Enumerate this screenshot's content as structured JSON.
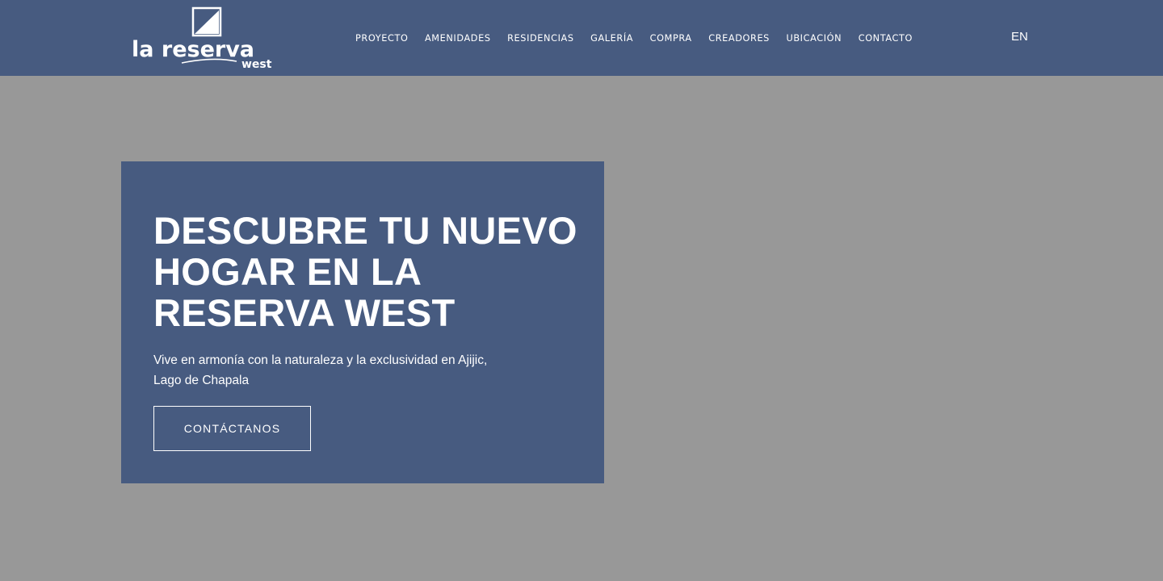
{
  "brand": {
    "logo_main": "la reserva",
    "logo_sub": "west"
  },
  "nav": {
    "items": [
      {
        "label": "PROYECTO"
      },
      {
        "label": "AMENIDADES"
      },
      {
        "label": "RESIDENCIAS"
      },
      {
        "label": "GALERÍA"
      },
      {
        "label": "COMPRA"
      },
      {
        "label": "CREADORES"
      },
      {
        "label": "UBICACIÓN"
      },
      {
        "label": "CONTACTO"
      }
    ],
    "language": "EN"
  },
  "hero": {
    "title_lines": [
      "DESCUBRE TU NUEVO",
      "HOGAR EN LA",
      "RESERVA WEST"
    ],
    "subtitle_lines": [
      "Vive en armonía con la naturaleza y la exclusividad en Ajijic,",
      "Lago de Chapala"
    ],
    "cta_label": "CONTÁCTANOS"
  },
  "colors": {
    "header_bg": "#475b80",
    "hero_box_bg": "#475b80",
    "page_bg": "#989898",
    "text": "#ffffff"
  }
}
